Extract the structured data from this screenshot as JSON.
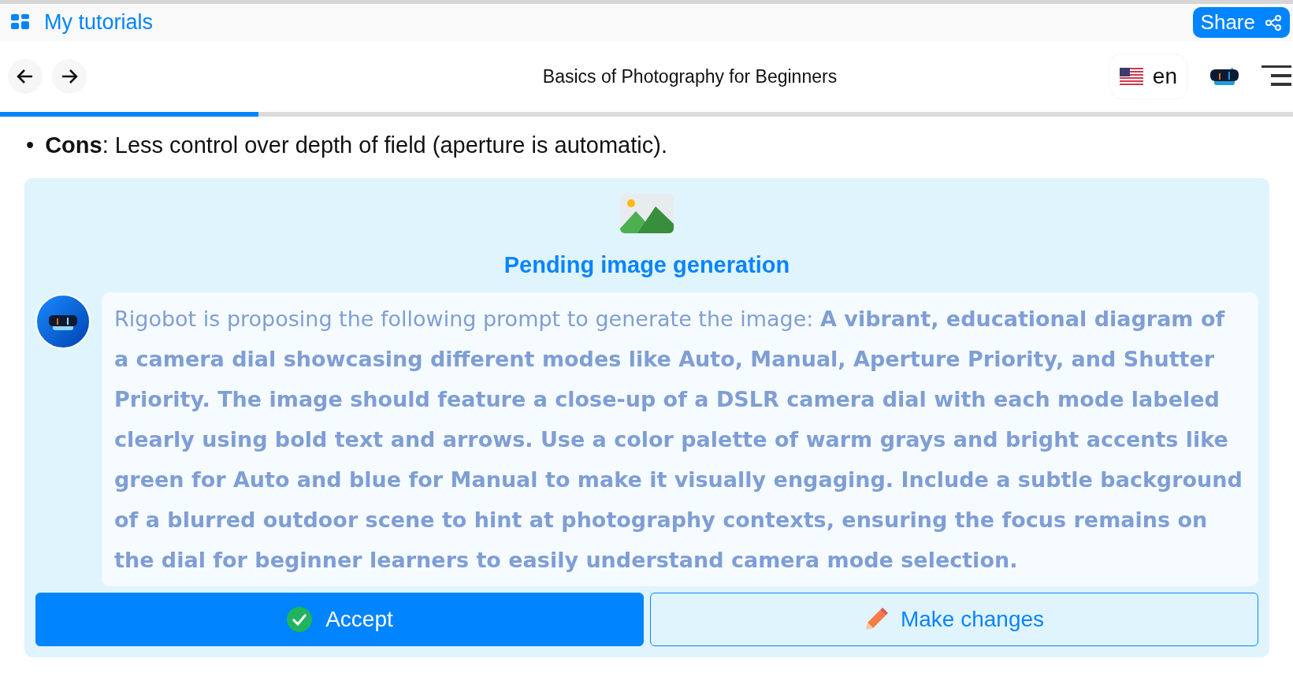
{
  "header": {
    "link": "My tutorials",
    "share_button": "Share"
  },
  "nav": {
    "title": "Basics of Photography for Beginners",
    "language": "en",
    "progress": {
      "level": 0.2
    }
  },
  "content": {
    "bullets": [
      {
        "marker": "•",
        "label": "Cons",
        "text": ": Less control over depth of field (aperture is automatic)."
      }
    ]
  },
  "image_panel": {
    "title": "Pending image generation",
    "prompt": "Rigobot is proposing the following prompt to generate the image: **A vibrant, educational diagram of a camera dial showcasing different modes like Auto, Manual, Aperture Priority, and Shutter Priority. The image should feature a close-up of a DSLR camera dial with each mode labeled clearly using bold text and arrows. Use a color palette of warm grays and bright accents like green for Auto and blue for Manual to make it visually engaging. Include a subtle background of a blurred outdoor scene to hint at photography contexts, ensuring the focus remains on the dial for beginner learners to easily understand camera mode selection.**",
    "buttons": [
      {
        "label": "Accept",
        "kind": "primary"
      },
      {
        "label": "Make changes",
        "kind": "secondary"
      }
    ]
  }
}
